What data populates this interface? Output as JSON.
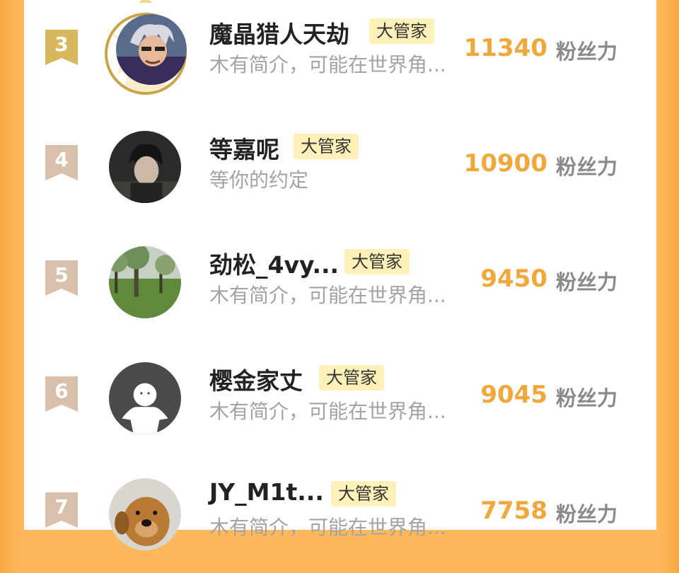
{
  "ranking": {
    "rows": [
      {
        "rank": "3",
        "name": "魔晶猎人天劫",
        "tag": "大管家",
        "desc": "木有简介，可能在世界角...",
        "score": "11340",
        "unit": "粉丝力"
      },
      {
        "rank": "4",
        "name": "等嘉呢",
        "tag": "大管家",
        "desc": "等你的约定",
        "score": "10900",
        "unit": "粉丝力"
      },
      {
        "rank": "5",
        "name": "劲松_4vy...",
        "tag": "大管家",
        "desc": "木有简介，可能在世界角...",
        "score": "9450",
        "unit": "粉丝力"
      },
      {
        "rank": "6",
        "name": "樱金家丈",
        "tag": "大管家",
        "desc": "木有简介，可能在世界角...",
        "score": "9045",
        "unit": "粉丝力"
      },
      {
        "rank": "7",
        "name": "JY_M1t...",
        "tag": "大管家",
        "desc": "木有简介，可能在世界角...",
        "score": "7758",
        "unit": "粉丝力"
      }
    ]
  },
  "colors": {
    "accent_orange": "#f2a73b",
    "tag_bg": "#fdf0b8",
    "badge_gold": "#d7b85e",
    "badge_tan": "#d9c0ab"
  }
}
